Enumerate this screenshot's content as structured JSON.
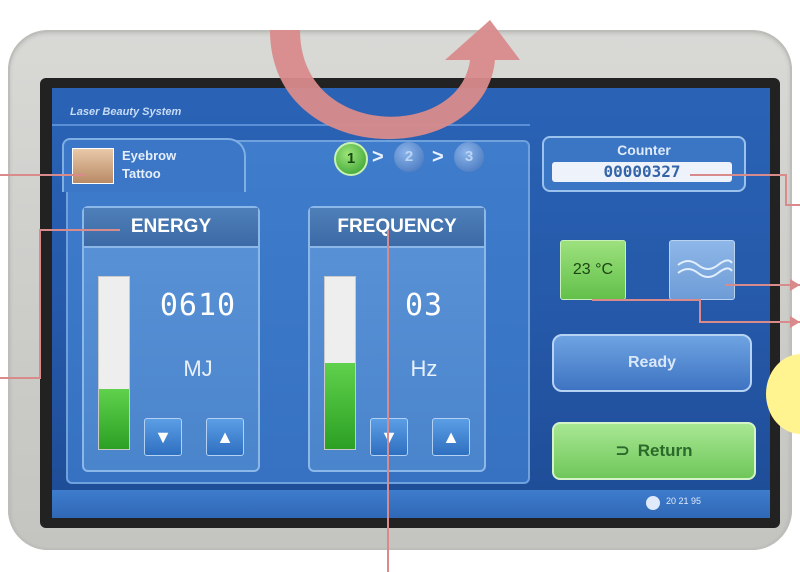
{
  "app": {
    "title": "Laser Beauty System"
  },
  "program": {
    "line1": "Eyebrow",
    "line2": "Tattoo"
  },
  "steps": {
    "s1": "1",
    "s2": "2",
    "s3": "3",
    "chevron": ">"
  },
  "energy": {
    "label": "ENERGY",
    "value": "0610",
    "unit": "MJ",
    "level": 0.35
  },
  "frequency": {
    "label": "FREQUENCY",
    "value": "03",
    "unit": "Hz",
    "level": 0.5
  },
  "buttons": {
    "down_glyph": "▼",
    "up_glyph": "▲"
  },
  "counter": {
    "label": "Counter",
    "value": "00000327"
  },
  "temperature": {
    "value": "23 °C"
  },
  "ready": {
    "label": "Ready"
  },
  "return_btn": {
    "label": "Return",
    "icon": "return-arrow-icon"
  },
  "status": {
    "time": "20 21 95"
  },
  "colors": {
    "annotation_arrow": "#d98b8b",
    "screen_blue": "#2558a8",
    "accent_green": "#2ca024"
  }
}
